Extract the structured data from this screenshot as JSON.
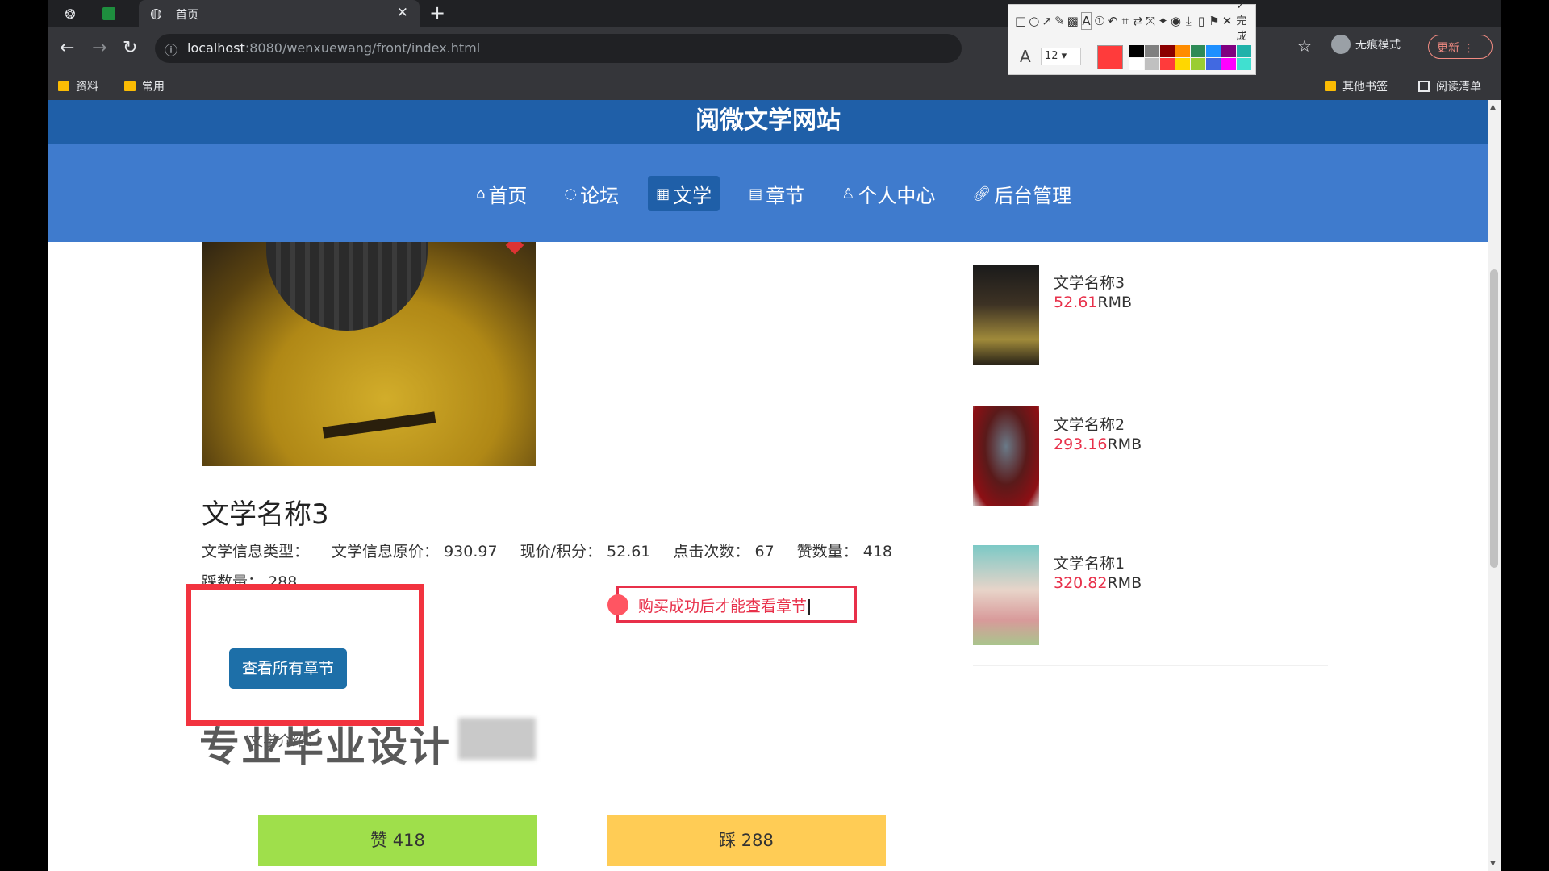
{
  "browser": {
    "tab_title": "首页",
    "url_host": "localhost",
    "url_rest": ":8080/wenxuewang/front/index.html",
    "bookmarks": [
      "资料",
      "常用"
    ],
    "other_bookmarks": "其他书签",
    "reading_list": "阅读清单",
    "incognito_label": "无痕模式",
    "update_label": "更新"
  },
  "annotation_tool": {
    "done_label": "完成",
    "font_size": "12",
    "current_color": "#ff3b3b",
    "palette": [
      "#000000",
      "#808080",
      "#8b0000",
      "#ff8c00",
      "#2e8b57",
      "#1e90ff",
      "#800080",
      "#20b2aa",
      "#ffffff",
      "#c0c0c0",
      "#ff3b3b",
      "#ffd700",
      "#9acd32",
      "#4169e1",
      "#ff00ff",
      "#40e0d0"
    ]
  },
  "site": {
    "title": "阅微文学网站",
    "nav": [
      {
        "label": "首页",
        "icon": "home-icon"
      },
      {
        "label": "论坛",
        "icon": "forum-icon"
      },
      {
        "label": "文学",
        "icon": "book-icon",
        "active": true
      },
      {
        "label": "章节",
        "icon": "chapter-icon"
      },
      {
        "label": "个人中心",
        "icon": "user-icon"
      },
      {
        "label": "后台管理",
        "icon": "link-icon"
      }
    ]
  },
  "book": {
    "title": "文学名称3",
    "type_label": "文学信息类型：",
    "type_value": "",
    "orig_price_label": "文学信息原价：",
    "orig_price": "930.97",
    "price_label": "现价/积分：",
    "price": "52.61",
    "clicks_label": "点击次数：",
    "clicks": "67",
    "likes_label": "赞数量：",
    "likes": "418",
    "dislikes_label": "踩数量：",
    "dislikes": "288",
    "view_chapters_button": "查看所有章节",
    "intro_label": "文学介绍：",
    "watermark": "专业毕业设计",
    "notice": "购买成功后才能查看章节",
    "like_button": "赞  418",
    "dislike_button": "踩  288"
  },
  "sidebar": [
    {
      "name": "文学名称3",
      "price": "52.61",
      "unit": "RMB"
    },
    {
      "name": "文学名称2",
      "price": "293.16",
      "unit": "RMB"
    },
    {
      "name": "文学名称1",
      "price": "320.82",
      "unit": "RMB"
    }
  ]
}
